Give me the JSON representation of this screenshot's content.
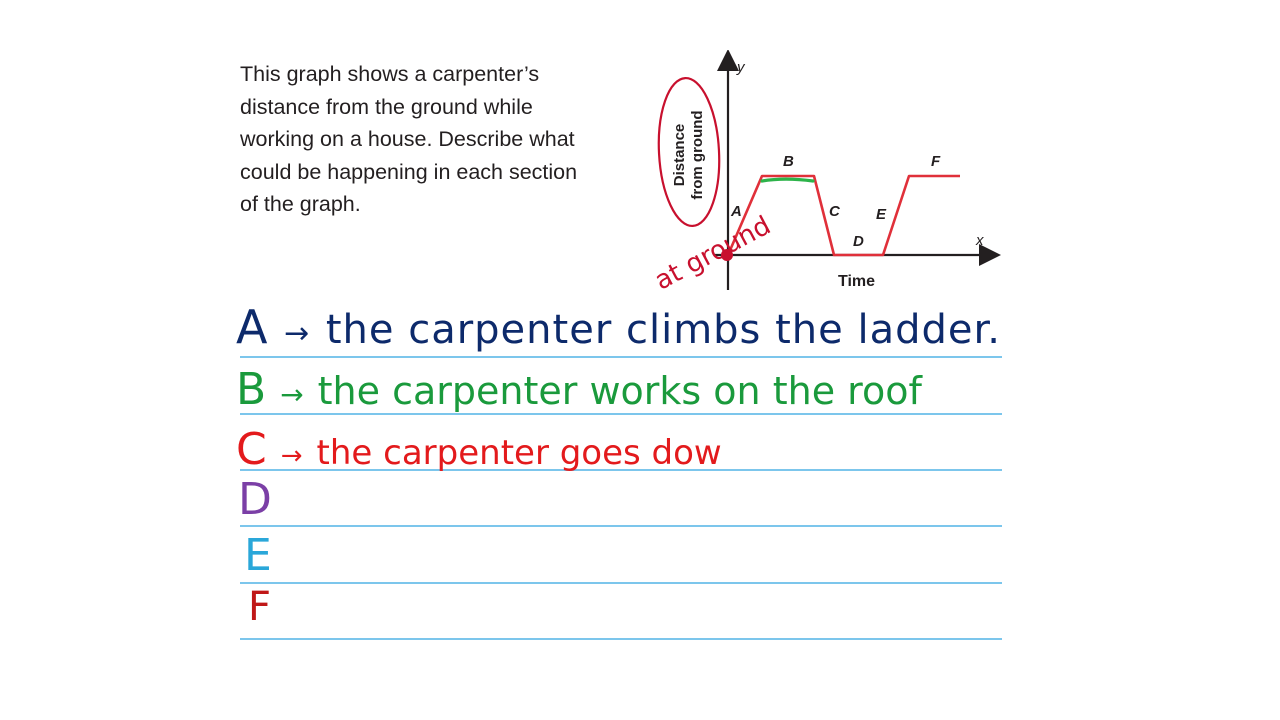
{
  "problem": {
    "lines": [
      "This graph shows a carpenter’s",
      "distance from the ground while",
      "working on a house. Describe what",
      "could be happening in each section",
      "of the graph."
    ]
  },
  "graph": {
    "y_label": "y",
    "x_label": "x",
    "y_axis_title_line1": "Distance",
    "y_axis_title_line2": "from ground",
    "x_axis_title": "Time",
    "sections": [
      "A",
      "B",
      "C",
      "D",
      "E",
      "F"
    ]
  },
  "annotation": {
    "handwritten_note": "at ground"
  },
  "answers": [
    {
      "letter": "A",
      "arrow": "→",
      "text": "the carpenter climbs the ladder.",
      "color": "#0d2a6b"
    },
    {
      "letter": "B",
      "arrow": "→",
      "text": "the carpenter works on the roof",
      "color": "#1a9a3c"
    },
    {
      "letter": "C",
      "arrow": "→",
      "text": "the carpenter goes dow",
      "color": "#e31a1c"
    },
    {
      "letter": "D",
      "arrow": "",
      "text": "",
      "color": "#7b3fa6"
    },
    {
      "letter": "E",
      "arrow": "",
      "text": "",
      "color": "#2aa7d9"
    },
    {
      "letter": "F",
      "arrow": "",
      "text": "",
      "color": "#c01818"
    }
  ],
  "colors": {
    "graph_line": "#e0303a",
    "axis": "#231f20",
    "highlight_green": "#2db34a",
    "rule_line": "#7cc6ec",
    "circle_red": "#c8102e"
  }
}
